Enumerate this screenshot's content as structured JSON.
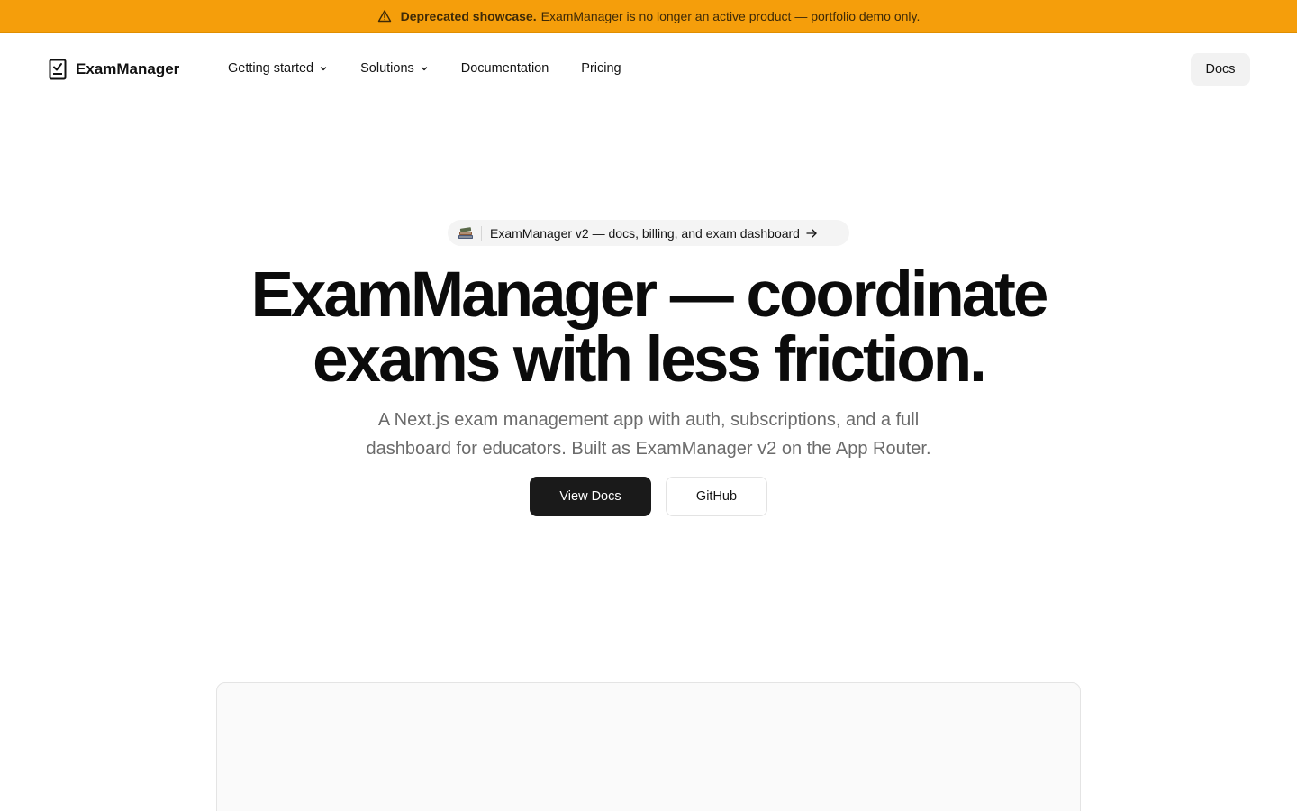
{
  "banner": {
    "strong": "Deprecated showcase.",
    "text": "ExamManager is no longer an active product — portfolio demo only.",
    "icon": "warning-triangle-icon",
    "color": "#f59e0b"
  },
  "nav": {
    "brand": "ExamManager",
    "links": [
      {
        "label": "Getting started",
        "has_dropdown": true
      },
      {
        "label": "Solutions",
        "has_dropdown": true
      },
      {
        "label": "Documentation",
        "has_dropdown": false
      },
      {
        "label": "Pricing",
        "has_dropdown": false
      }
    ],
    "docs_button": "Docs"
  },
  "hero": {
    "pill_text": "ExamManager v2 — docs, billing, and exam dashboard",
    "title_line1": "ExamManager — coordinate",
    "title_line2": "exams with less friction.",
    "subtitle_line1": "A Next.js exam management app with auth, subscriptions, and a full",
    "subtitle_line2": "dashboard for educators. Built as ExamManager v2 on the App Router.",
    "primary_button": "View Docs",
    "secondary_button": "GitHub"
  },
  "colors": {
    "primary_button_bg": "#1a1a1a",
    "banner_bg": "#f59e0b",
    "subtitle_text": "#6b6b6b"
  }
}
